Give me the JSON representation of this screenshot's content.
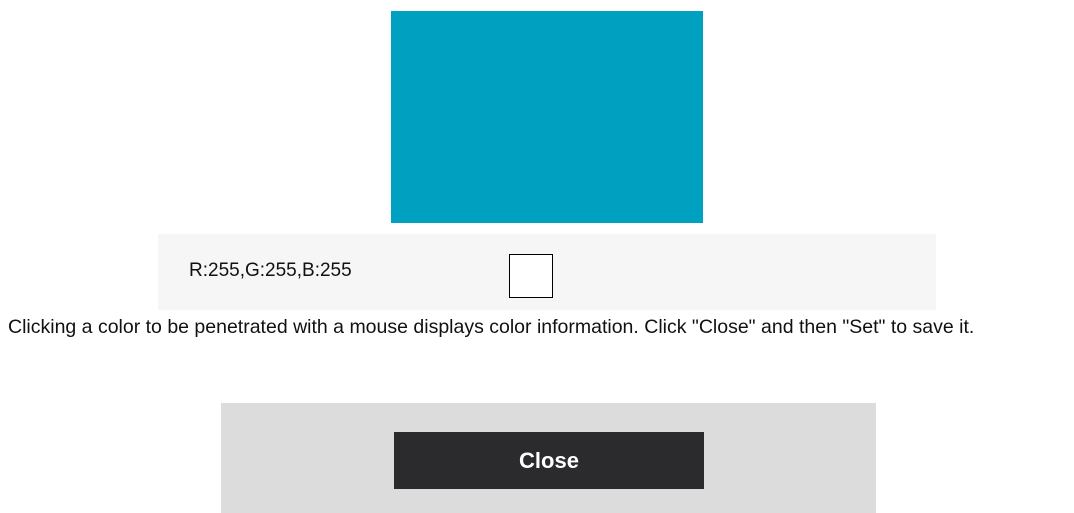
{
  "picker": {
    "preview_color": "#00a0c0",
    "rgb_text": "R:255,G:255,B:255",
    "selected_swatch_color": "#ffffff"
  },
  "instructions": {
    "text": "Clicking a color to be penetrated with a mouse displays color information. Click \"Close\" and then \"Set\" to save it."
  },
  "footer": {
    "close_label": "Close"
  },
  "colors": {
    "info_bar_bg": "#f6f6f6",
    "footer_bg": "#dcdcdc",
    "button_bg": "#2b2b2d",
    "button_text": "#ffffff"
  }
}
